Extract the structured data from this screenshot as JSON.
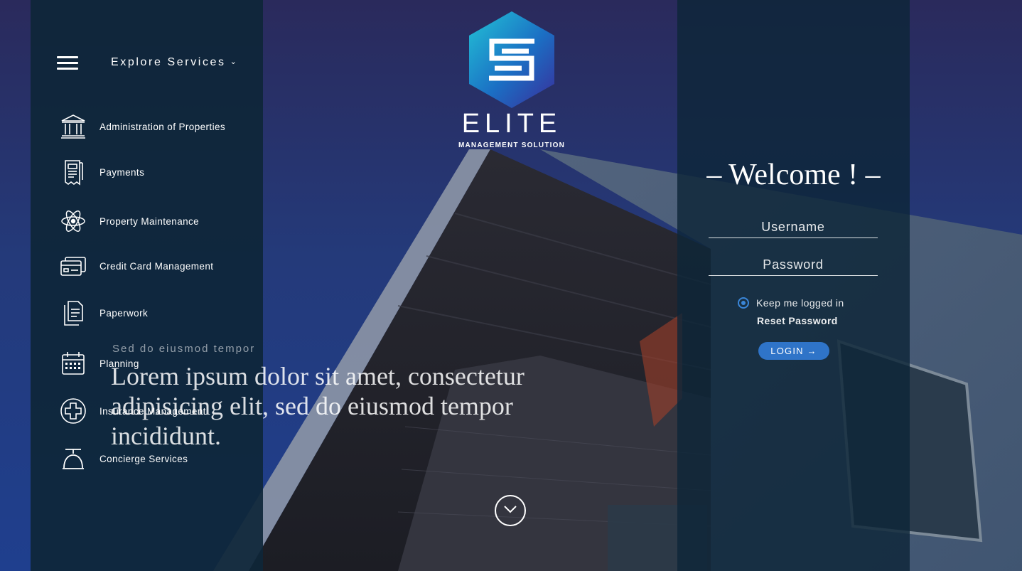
{
  "brand": {
    "name": "ELITE",
    "tagline": "MANAGEMENT SOLUTION",
    "logo_icon": "hexagon-s-logo-icon"
  },
  "nav": {
    "menu_icon": "hamburger-icon",
    "explore_label": "Explore Services",
    "explore_chevron": "⌄",
    "items": [
      {
        "label": "Administration of Properties",
        "icon": "bank-icon"
      },
      {
        "label": "Payments",
        "icon": "receipt-icon"
      },
      {
        "label": "Property Maintenance",
        "icon": "atom-icon"
      },
      {
        "label": "Credit Card Management",
        "icon": "credit-card-icon"
      },
      {
        "label": "Paperwork",
        "icon": "documents-icon"
      },
      {
        "label": "Planning",
        "icon": "calendar-icon"
      },
      {
        "label": "Insurance Management",
        "icon": "plus-circle-icon"
      },
      {
        "label": "Concierge Services",
        "icon": "service-bell-icon"
      }
    ]
  },
  "hero": {
    "kicker": "Sed do eiusmod tempor",
    "title": "Lorem ipsum dolor sit amet, consectetur adipisicing elit, sed do eiusmod tempor incididunt.",
    "scroll_icon": "chevron-down-circle-icon"
  },
  "login": {
    "welcome": "– Welcome ! –",
    "username_placeholder": "Username",
    "password_placeholder": "Password",
    "remember_label": "Keep me logged in",
    "remember_checked": true,
    "reset_label": "Reset Password",
    "submit_label": "LOGIN →"
  },
  "colors": {
    "panel": "#0e2638",
    "accent": "#2f74c8",
    "bg_top": "#2a2a5c",
    "bg_bottom": "#1f3f8e"
  }
}
